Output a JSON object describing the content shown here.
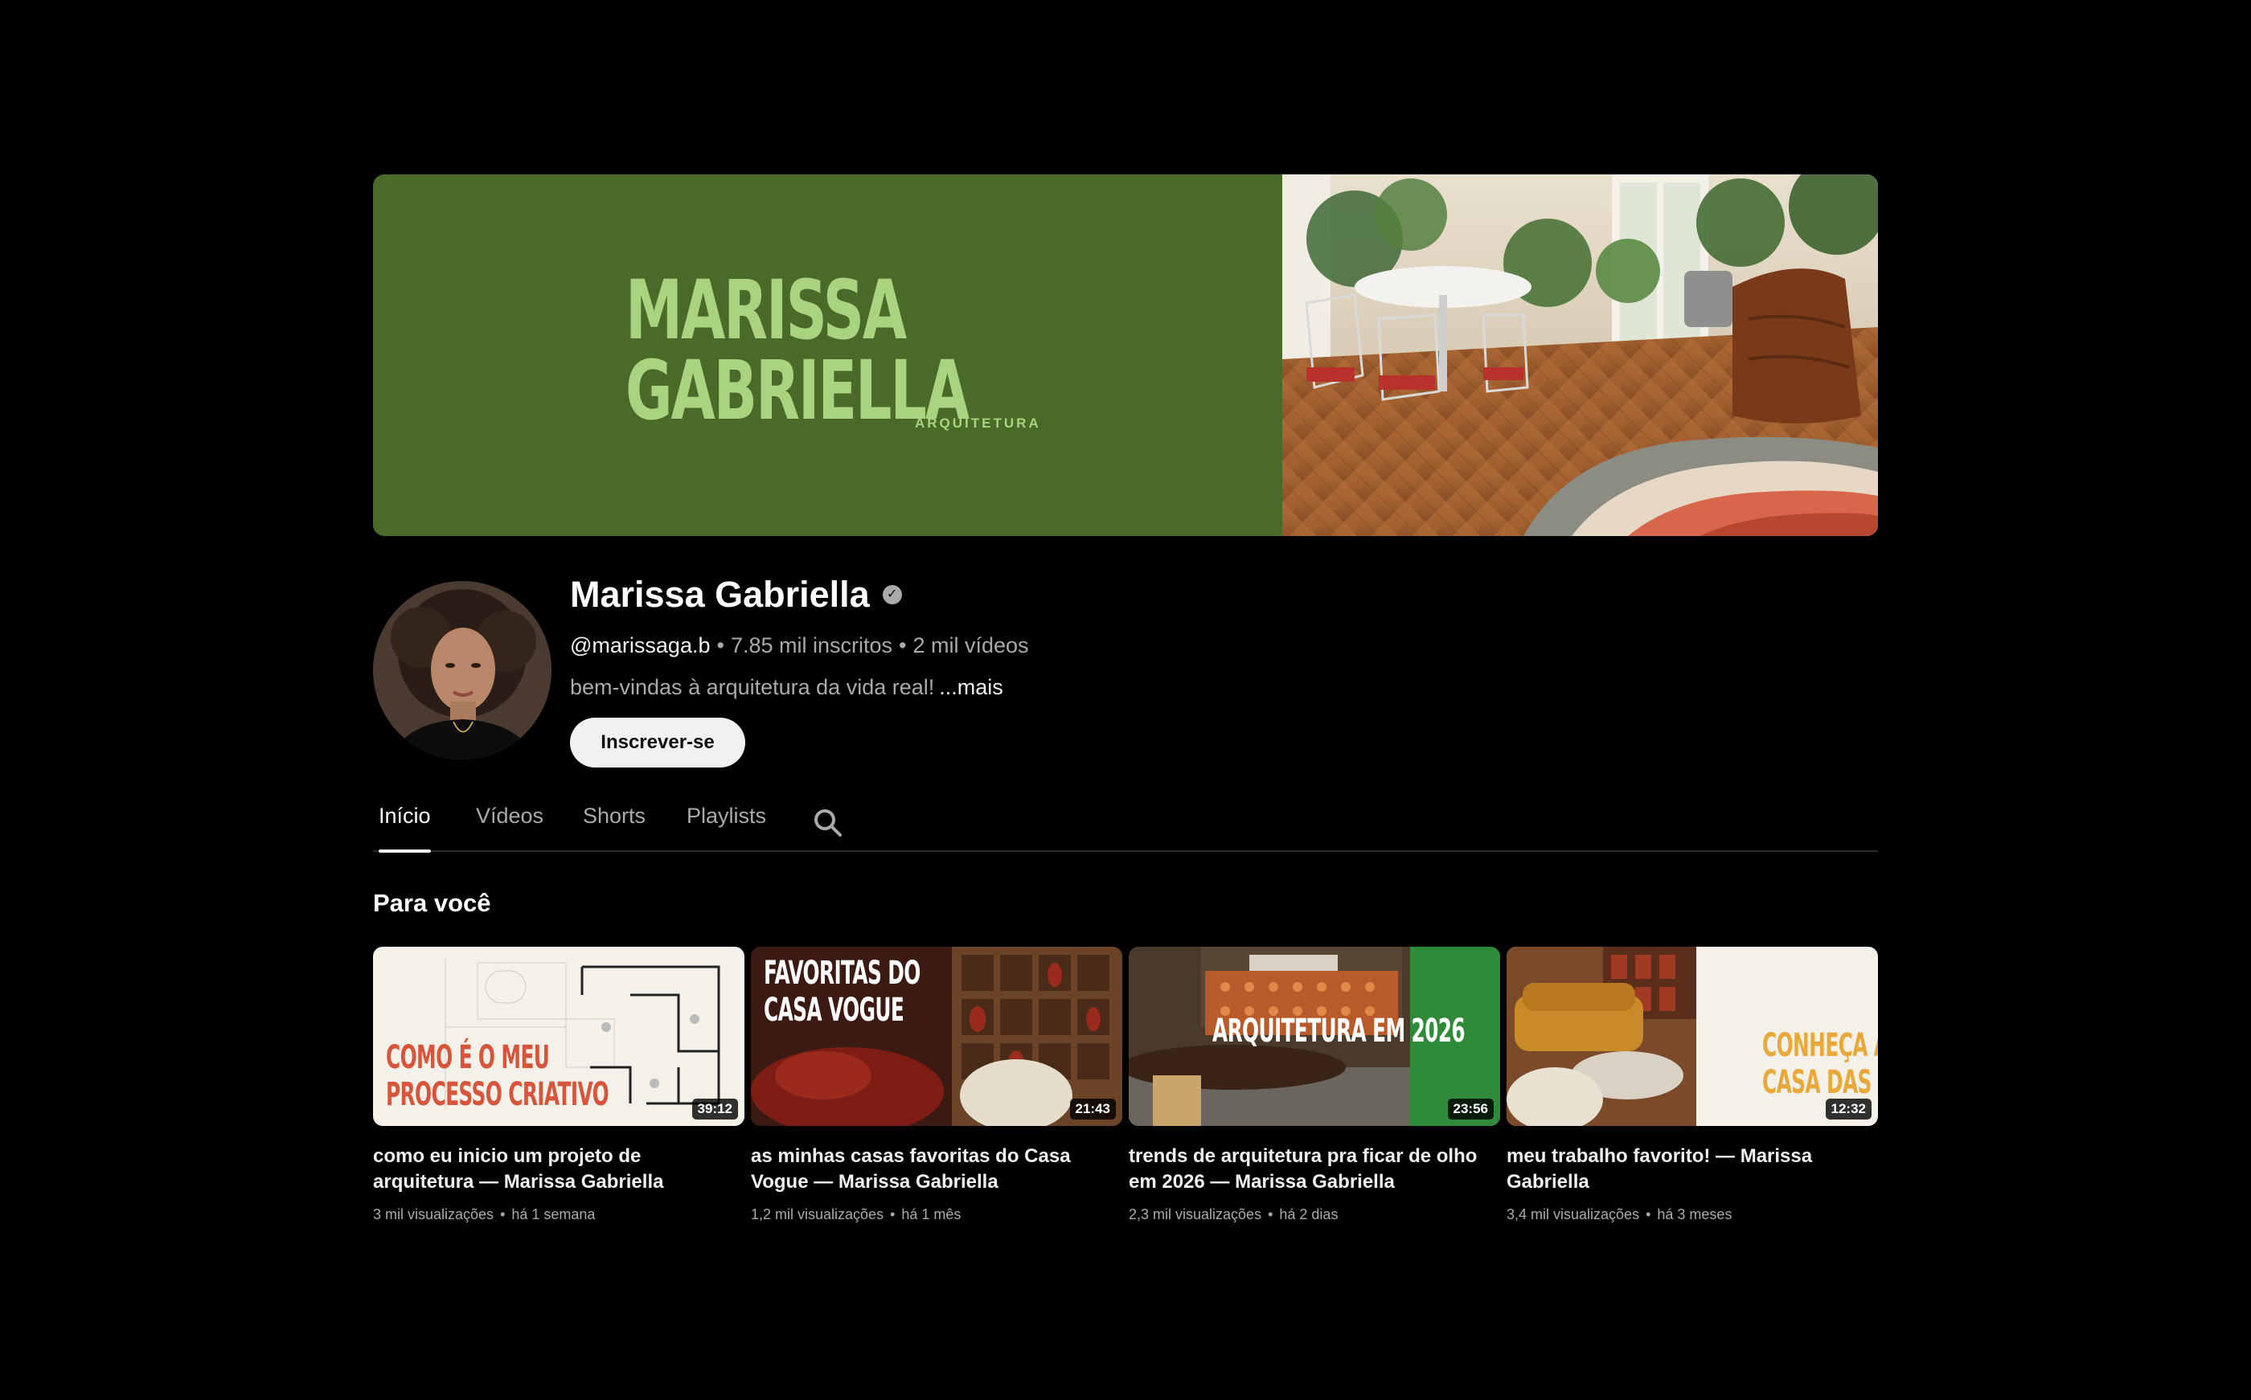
{
  "banner": {
    "name_line1": "MARISSA",
    "name_line2": "GABRIELLA",
    "subtitle": "ARQUITETURA",
    "bg_color": "#4a6a2a",
    "text_color": "#a9d37e"
  },
  "channel": {
    "name": "Marissa Gabriella",
    "handle": "@marissaga.b",
    "subscribers": "7.85 mil inscritos",
    "videos_count": "2 mil vídeos",
    "description": "bem-vindas à arquitetura da vida real!",
    "more": "...mais",
    "subscribe_label": "Inscrever-se"
  },
  "tabs": [
    {
      "label": "Início",
      "active": true
    },
    {
      "label": "Vídeos",
      "active": false
    },
    {
      "label": "Shorts",
      "active": false
    },
    {
      "label": "Playlists",
      "active": false
    }
  ],
  "section": {
    "title": "Para você"
  },
  "videos": [
    {
      "thumb_text_line1": "COMO É O MEU",
      "thumb_text_line2": "PROCESSO CRIATIVO",
      "duration": "39:12",
      "title": "como eu inicio um projeto de arquitetura — Marissa Gabriella",
      "views": "3 mil visualizações",
      "age": "há 1 semana"
    },
    {
      "thumb_text_line1": "FAVORITAS DO",
      "thumb_text_line2": "CASA VOGUE",
      "duration": "21:43",
      "title": "as minhas casas favoritas do Casa Vogue — Marissa Gabriella",
      "views": "1,2 mil visualizações",
      "age": "há 1 mês"
    },
    {
      "thumb_text_line1": "ARQUITETURA EM 2026",
      "thumb_text_line2": "",
      "duration": "23:56",
      "title": "trends de arquitetura pra ficar de olho em 2026 — Marissa Gabriella",
      "views": "2,3 mil visualizações",
      "age": "há 2 dias"
    },
    {
      "thumb_text_line1": "CONHEÇA A",
      "thumb_text_line2": "CASA DAS CORES",
      "duration": "12:32",
      "title": "meu trabalho favorito! — Marissa Gabriella",
      "views": "3,4 mil visualizações",
      "age": "há 3 meses"
    }
  ]
}
